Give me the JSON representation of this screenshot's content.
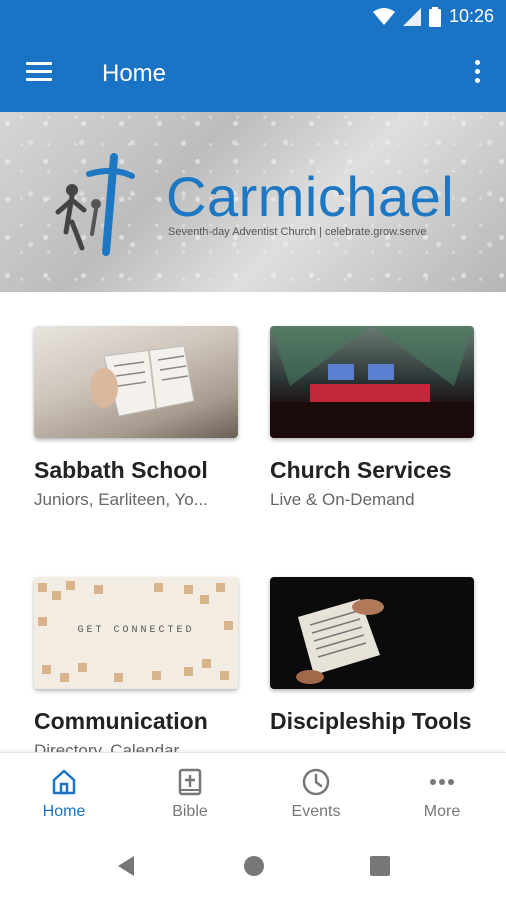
{
  "status_bar": {
    "time": "10:26",
    "wifi_icon": "wifi-icon",
    "signal_icon": "cell-signal-icon",
    "battery_icon": "battery-icon"
  },
  "app_bar": {
    "title": "Home",
    "menu_icon": "hamburger-menu-icon",
    "overflow_icon": "more-vert-icon"
  },
  "hero": {
    "brand": "Carmichael",
    "tagline": "Seventh-day Adventist Church | celebrate.grow.serve"
  },
  "cards": [
    {
      "title": "Sabbath School",
      "subtitle": "Juniors, Earliteen, Yo..."
    },
    {
      "title": "Church Services",
      "subtitle": "Live & On-Demand"
    },
    {
      "title": "Communication",
      "subtitle": "Directory, Calendar"
    },
    {
      "title": "Discipleship Tools",
      "subtitle": ""
    }
  ],
  "thumb_texts": {
    "get_connected": "GET CONNECTED"
  },
  "bottom_nav": [
    {
      "label": "Home",
      "icon": "home-icon",
      "active": true
    },
    {
      "label": "Bible",
      "icon": "bible-icon",
      "active": false
    },
    {
      "label": "Events",
      "icon": "clock-icon",
      "active": false
    },
    {
      "label": "More",
      "icon": "more-horiz-icon",
      "active": false
    }
  ],
  "colors": {
    "primary": "#1a73c4",
    "inactive": "#777777"
  }
}
